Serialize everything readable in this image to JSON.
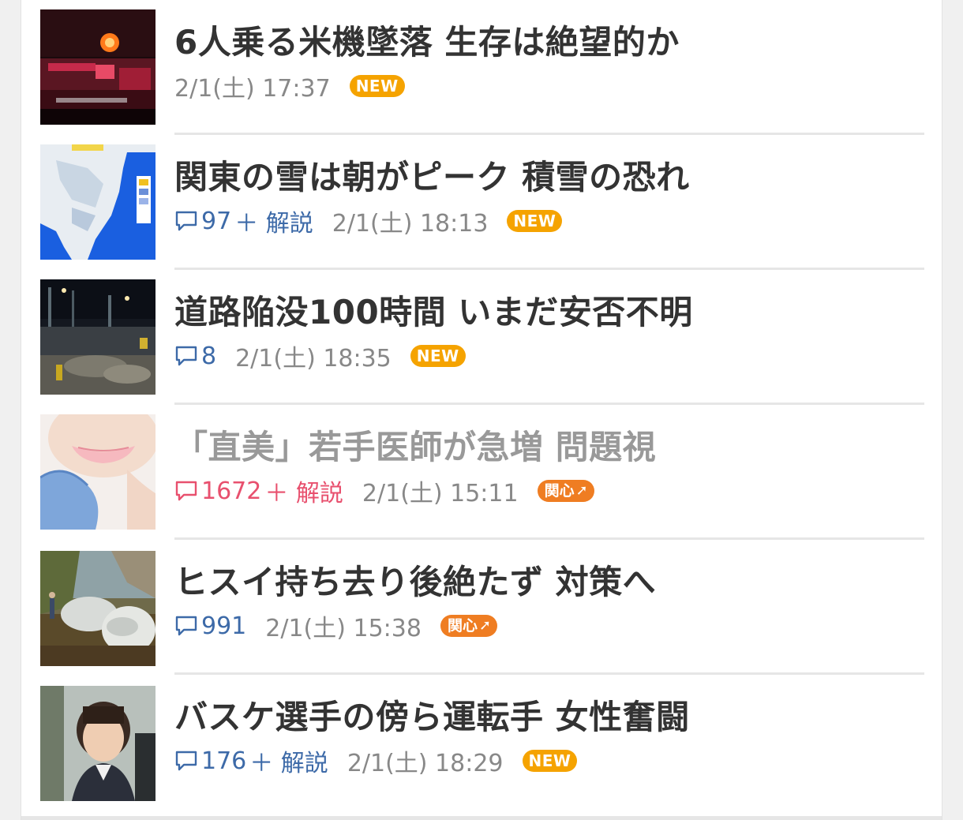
{
  "articles": [
    {
      "title": "6人乗る米機墜落 生存は絶望的か",
      "comments": "",
      "commentary": "",
      "date": "2/1(土) 17:37",
      "badge": "NEW",
      "thumb": "fire-scene"
    },
    {
      "title": "関東の雪は朝がピーク 積雪の恐れ",
      "comments": "97",
      "commentary": "＋ 解説",
      "date": "2/1(土) 18:13",
      "badge": "NEW",
      "thumb": "snow-map"
    },
    {
      "title": "道路陥没100時間 いまだ安否不明",
      "comments": "8",
      "commentary": "",
      "date": "2/1(土) 18:35",
      "badge": "NEW",
      "thumb": "night-site"
    },
    {
      "title": "「直美」若手医師が急増 問題視",
      "comments": "1672",
      "commentary": "＋ 解説",
      "date": "2/1(土) 15:11",
      "badge": "関心",
      "thumb": "face-glove"
    },
    {
      "title": "ヒスイ持ち去り後絶たず 対策へ",
      "comments": "991",
      "commentary": "",
      "date": "2/1(土) 15:38",
      "badge": "関心",
      "thumb": "jade-rocks"
    },
    {
      "title": "バスケ選手の傍ら運転手 女性奮闘",
      "comments": "176",
      "commentary": "＋ 解説",
      "date": "2/1(土) 18:29",
      "badge": "NEW",
      "thumb": "woman-portrait"
    }
  ],
  "colors": {
    "comment_link": "#3d6aa8",
    "comment_hot": "#e8506e",
    "badge_new": "#f5a300",
    "badge_interest": "#ef7d22",
    "title": "#333333",
    "title_visited": "#999999"
  }
}
